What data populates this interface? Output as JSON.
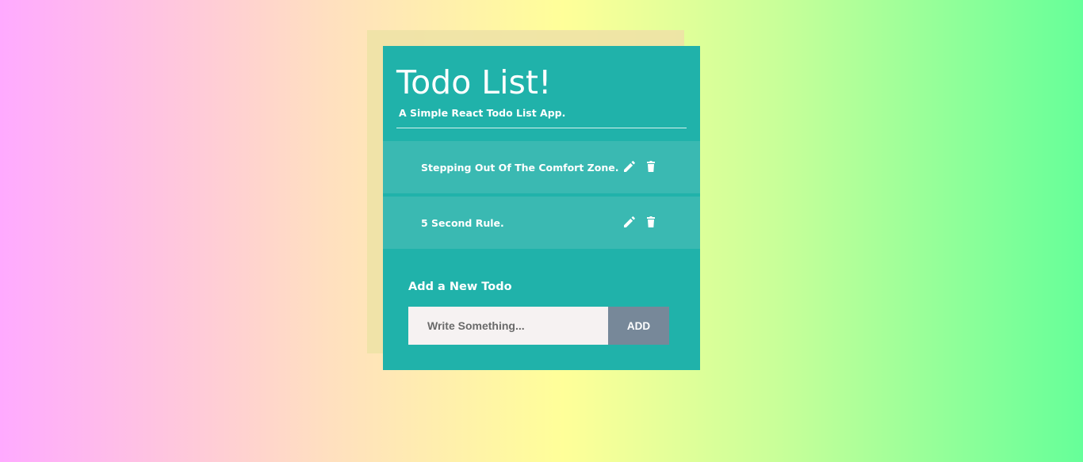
{
  "app": {
    "title": "Todo List!",
    "subtitle": "A Simple React Todo List App."
  },
  "todos": [
    {
      "text": "Stepping Out Of The Comfort Zone."
    },
    {
      "text": "5 Second Rule."
    }
  ],
  "icons": {
    "edit": "pencil-icon",
    "delete": "trash-icon"
  },
  "form": {
    "label": "Add a New Todo",
    "input_value": "",
    "input_placeholder": "Write Something...",
    "add_button_label": "ADD"
  },
  "colors": {
    "card": "#20b2aa",
    "item": "#3ab9b2",
    "back_card": "#eee2a6",
    "input_bg": "#f6f2f2",
    "button_bg": "#778899",
    "text": "#ffffff"
  }
}
